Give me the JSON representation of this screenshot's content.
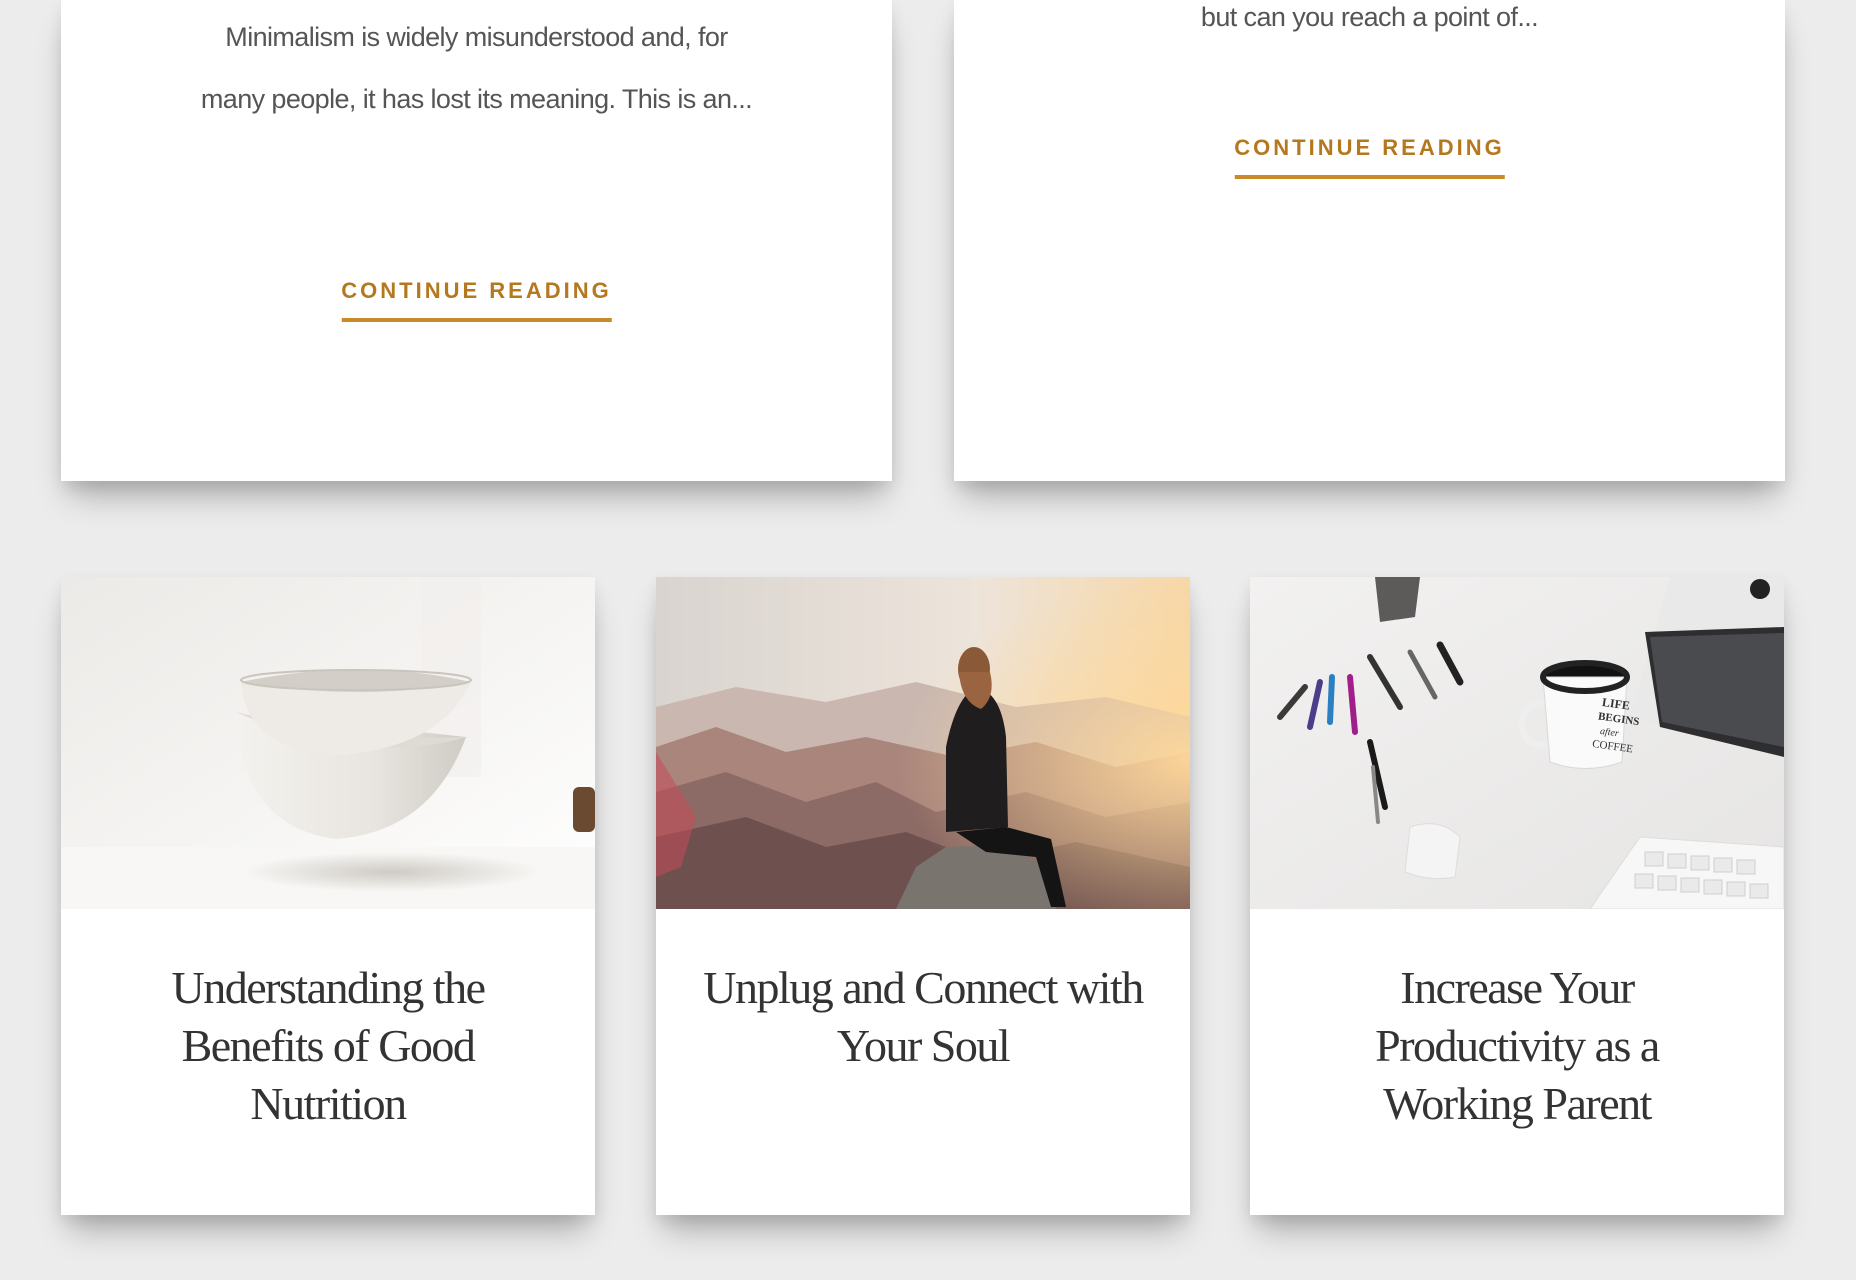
{
  "posts_top": [
    {
      "excerpt": "Minimalism is widely misunderstood and, for many people, it has lost its meaning. This is an...",
      "cta": "CONTINUE READING"
    },
    {
      "excerpt": "but can you reach a point of...",
      "cta": "CONTINUE READING"
    }
  ],
  "posts_bottom": [
    {
      "title": "Understanding the Benefits of Good Nutrition",
      "image": "white-bowls-photo"
    },
    {
      "title": "Unplug and Connect with Your Soul",
      "image": "woman-on-mountain-photo"
    },
    {
      "title": "Increase Your Productivity as a Working Parent",
      "image": "desk-with-coffee-mug-photo",
      "image_text": "LIFE BEGINS after COFFEE"
    }
  ],
  "colors": {
    "accent": "#b5781f",
    "underline": "#c98a2a",
    "page_bg": "#ececec",
    "card_bg": "#ffffff",
    "title_text": "#333333",
    "body_text": "#555555"
  }
}
